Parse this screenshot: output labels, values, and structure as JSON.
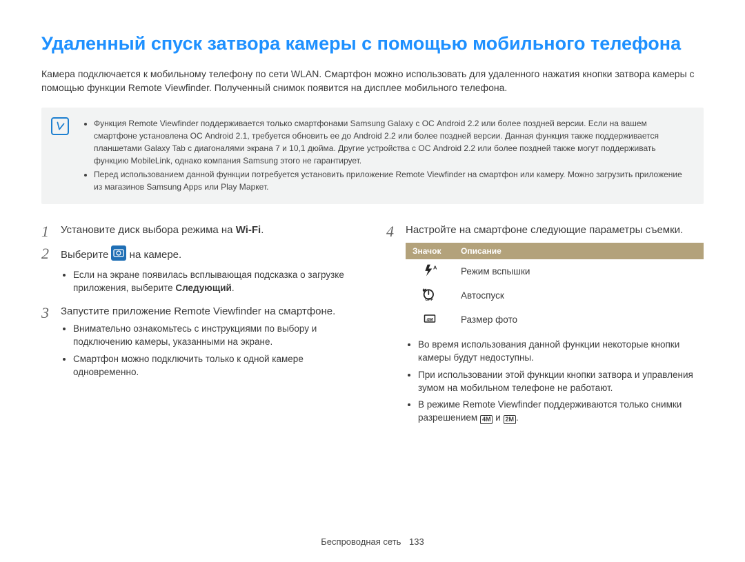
{
  "title": "Удаленный спуск затвора камеры с помощью мобильного телефона",
  "intro": "Камера подключается к мобильному телефону по сети WLAN. Смартфон можно использовать для удаленного нажатия кнопки затвора камеры с помощью функции Remote Viewfinder. Полученный снимок появится на дисплее мобильного телефона.",
  "notes": {
    "items": [
      "Функция Remote Viewfinder поддерживается только смартфонами Samsung Galaxy с ОС Android 2.2 или более поздней версии. Если на вашем смартфоне установлена ОС Android 2.1, требуется обновить ее до Android 2.2 или более поздней версии. Данная функция также поддерживается планшетами Galaxy Tab с диагоналями экрана 7 и 10,1 дюйма. Другие устройства с ОС Android 2.2 или более поздней также могут поддерживать функцию MobileLink, однако компания Samsung этого не гарантирует.",
      "Перед использованием данной функции потребуется установить приложение Remote Viewfinder на смартфон или камеру. Можно загрузить приложение из магазинов Samsung Apps или Play Маркет."
    ]
  },
  "left": {
    "step1": {
      "num": "1",
      "pre": "Установите диск выбора режима на ",
      "wifi": "Wi-Fi",
      "post": "."
    },
    "step2": {
      "num": "2",
      "pre": "Выберите ",
      "post": " на камере.",
      "sub": [
        {
          "a": "Если на экране появилась всплывающая подсказка о загрузке приложения, выберите ",
          "b": "Следующий",
          "c": "."
        }
      ]
    },
    "step3": {
      "num": "3",
      "text": "Запустите приложение Remote Viewfinder на смартфоне.",
      "sub": [
        "Внимательно ознакомьтесь с инструкциями по выбору и подключению камеры, указанными на экране.",
        "Смартфон можно подключить только к одной камере одновременно."
      ]
    }
  },
  "right": {
    "step4": {
      "num": "4",
      "text": "Настройте на смартфоне следующие параметры съемки."
    },
    "table": {
      "h1": "Значок",
      "h2": "Описание",
      "rows": [
        {
          "desc": "Режим вспышки"
        },
        {
          "desc": "Автоспуск"
        },
        {
          "desc": "Размер фото"
        }
      ]
    },
    "bullets": [
      "Во время использования данной функции некоторые кнопки камеры будут недоступны.",
      "При использовании этой функции кнопки затвора и управления зумом на мобильном телефоне не работают.",
      {
        "a": "В режиме Remote Viewfinder поддерживаются только снимки разрешением ",
        "m4": "4M",
        "mid": " и ",
        "m2": "2M",
        "c": "."
      }
    ]
  },
  "footer": {
    "section": "Беспроводная сеть",
    "page": "133"
  }
}
